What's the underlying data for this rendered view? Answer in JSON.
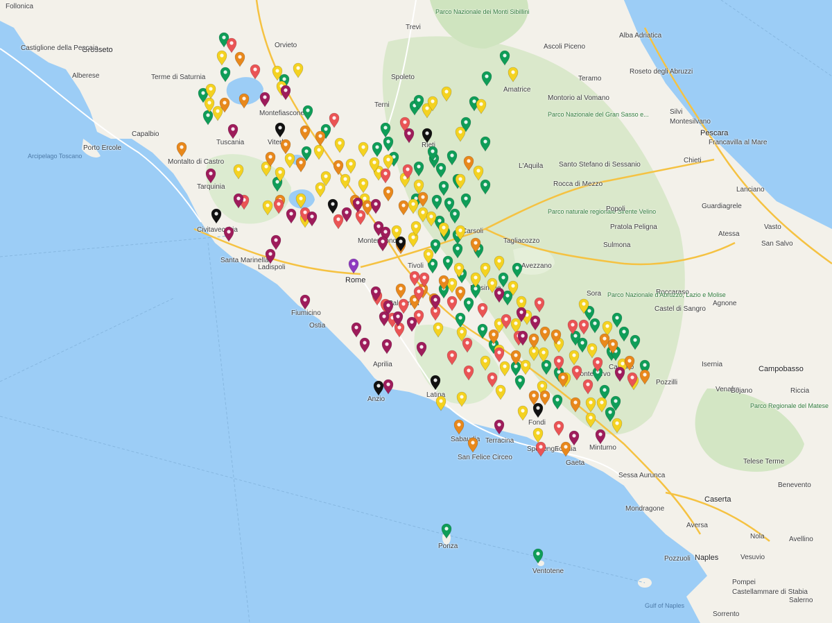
{
  "map": {
    "colors": {
      "sea": "#9ccdf6",
      "land": "#f3f1ea",
      "green_area": "#c9e5bd",
      "mountain": "#dbe7cf",
      "road_yellow": "#f5c242",
      "marker_green": "#0f9d58",
      "marker_yellow": "#f4d221",
      "marker_orange": "#e8881c",
      "marker_red": "#ea5455",
      "marker_maroon": "#9e1c5b",
      "marker_black": "#111111",
      "marker_purple": "#8e3ac0"
    },
    "labels": [
      {
        "text": "Follonica"
      },
      {
        "text": "Grosseto"
      },
      {
        "text": "Castiglione della Pescaia"
      },
      {
        "text": "Alberese"
      },
      {
        "text": "Terme di Saturnia"
      },
      {
        "text": "Capalbio"
      },
      {
        "text": "Porto Ercole"
      },
      {
        "text": "Arcipelago Toscano"
      },
      {
        "text": "Montalto di Castro"
      },
      {
        "text": "Tarquinia"
      },
      {
        "text": "Civitavecchia"
      },
      {
        "text": "Santa Marinella"
      },
      {
        "text": "Ladispoli"
      },
      {
        "text": "Fiumicino"
      },
      {
        "text": "Rome"
      },
      {
        "text": "Ostia"
      },
      {
        "text": "Aprilia"
      },
      {
        "text": "Anzio"
      },
      {
        "text": "Latina"
      },
      {
        "text": "Sabaudia"
      },
      {
        "text": "San Felice Circeo"
      },
      {
        "text": "Terracina"
      },
      {
        "text": "Fondi"
      },
      {
        "text": "Sperlonga"
      },
      {
        "text": "Formia"
      },
      {
        "text": "Gaeta"
      },
      {
        "text": "Minturno"
      },
      {
        "text": "Ponza"
      },
      {
        "text": "Ventotene"
      },
      {
        "text": "Viterbo"
      },
      {
        "text": "Tuscania"
      },
      {
        "text": "Orvieto"
      },
      {
        "text": "Montefiascone"
      },
      {
        "text": "Terni"
      },
      {
        "text": "Spoleto"
      },
      {
        "text": "Trevi"
      },
      {
        "text": "Rieti"
      },
      {
        "text": "Monterotondo"
      },
      {
        "text": "Tivoli"
      },
      {
        "text": "Carsoli"
      },
      {
        "text": "Tagliacozzo"
      },
      {
        "text": "Avezzano"
      },
      {
        "text": "L'Aquila"
      },
      {
        "text": "Teramo"
      },
      {
        "text": "Amatrice"
      },
      {
        "text": "Ascoli Piceno"
      },
      {
        "text": "Alba Adriatica"
      },
      {
        "text": "Roseto degli Abruzzi"
      },
      {
        "text": "Silvi"
      },
      {
        "text": "Montesilvano"
      },
      {
        "text": "Pescara"
      },
      {
        "text": "Francavilla al Mare"
      },
      {
        "text": "Chieti"
      },
      {
        "text": "Lanciano"
      },
      {
        "text": "Vasto"
      },
      {
        "text": "San Salvo"
      },
      {
        "text": "Sulmona"
      },
      {
        "text": "Atessa"
      },
      {
        "text": "Guardiagrele"
      },
      {
        "text": "Frosinone"
      },
      {
        "text": "Sora"
      },
      {
        "text": "Cassino"
      },
      {
        "text": "Pontecorvo"
      },
      {
        "text": "Isernia"
      },
      {
        "text": "Campobasso"
      },
      {
        "text": "Venafro"
      },
      {
        "text": "Pozzilli"
      },
      {
        "text": "Bojano"
      },
      {
        "text": "Riccia"
      },
      {
        "text": "Agnone"
      },
      {
        "text": "Castel di Sangro"
      },
      {
        "text": "Roccaraso"
      },
      {
        "text": "Telese Terme"
      },
      {
        "text": "Benevento"
      },
      {
        "text": "Caserta"
      },
      {
        "text": "Aversa"
      },
      {
        "text": "Naples"
      },
      {
        "text": "Vesuvio"
      },
      {
        "text": "Pozzuoli"
      },
      {
        "text": "Avellino"
      },
      {
        "text": "Nola"
      },
      {
        "text": "Pompei"
      },
      {
        "text": "Castellammare di Stabia"
      },
      {
        "text": "Sorrento"
      },
      {
        "text": "Salerno"
      },
      {
        "text": "Gulf of Naples"
      },
      {
        "text": "Mondragone"
      },
      {
        "text": "Sessa Aurunca"
      },
      {
        "text": "Parco Nazionale d'Abruzzo, Lazio e Molise"
      },
      {
        "text": "Parco naturale regionale Sirente Velino"
      },
      {
        "text": "Parco Nazionale del Gran Sasso e..."
      },
      {
        "text": "Parco Nazionale dei Monti Sibillini"
      },
      {
        "text": "Parco Regionale del Matese"
      },
      {
        "text": "Montorio al Vomano"
      },
      {
        "text": "Santo Stefano di Sessanio"
      },
      {
        "text": "Rocca di Mezzo"
      },
      {
        "text": "Popoli"
      },
      {
        "text": "Pratola Peligna"
      },
      {
        "text": "Palestrina"
      }
    ],
    "marker_groups": [
      {
        "color": "green",
        "count": 1
      },
      {
        "color": "yellow",
        "count": 1
      },
      {
        "color": "orange",
        "count": 1
      },
      {
        "color": "red",
        "count": 1
      },
      {
        "color": "maroon",
        "count": 1
      },
      {
        "color": "black",
        "count": 1
      },
      {
        "color": "purple",
        "count": 1
      }
    ]
  }
}
